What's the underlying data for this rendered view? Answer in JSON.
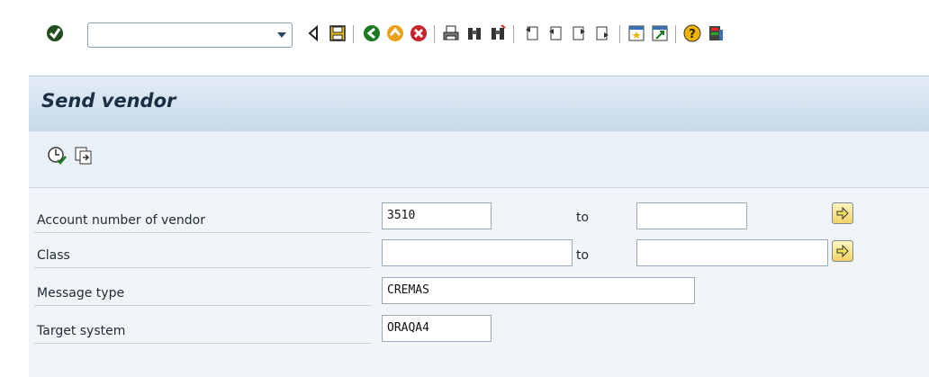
{
  "toolbar": {
    "command_field_value": "",
    "icons": [
      "enter-check-icon",
      "back-icon",
      "save-icon",
      "back-green-icon",
      "exit-icon",
      "cancel-icon",
      "print-icon",
      "find-icon",
      "find-next-icon",
      "first-page-icon",
      "prev-page-icon",
      "next-page-icon",
      "last-page-icon",
      "new-session-icon",
      "shortcut-icon",
      "help-icon",
      "customize-layout-icon"
    ]
  },
  "title": "Send vendor",
  "app_toolbar": {
    "icons": [
      "execute-icon",
      "get-variant-icon"
    ]
  },
  "form": {
    "rows": [
      {
        "label": "Account number of vendor",
        "from": "3510",
        "to_label": "to",
        "to": ""
      },
      {
        "label": "Class",
        "from": "",
        "to_label": "to",
        "to": ""
      },
      {
        "label": "Message type",
        "value": "CREMAS"
      },
      {
        "label": "Target system",
        "value": "ORAQA4"
      }
    ]
  },
  "colors": {
    "title_bg": "#d6e4f0",
    "form_bg": "#f1f4f8",
    "multi_button": "#f2d264"
  }
}
